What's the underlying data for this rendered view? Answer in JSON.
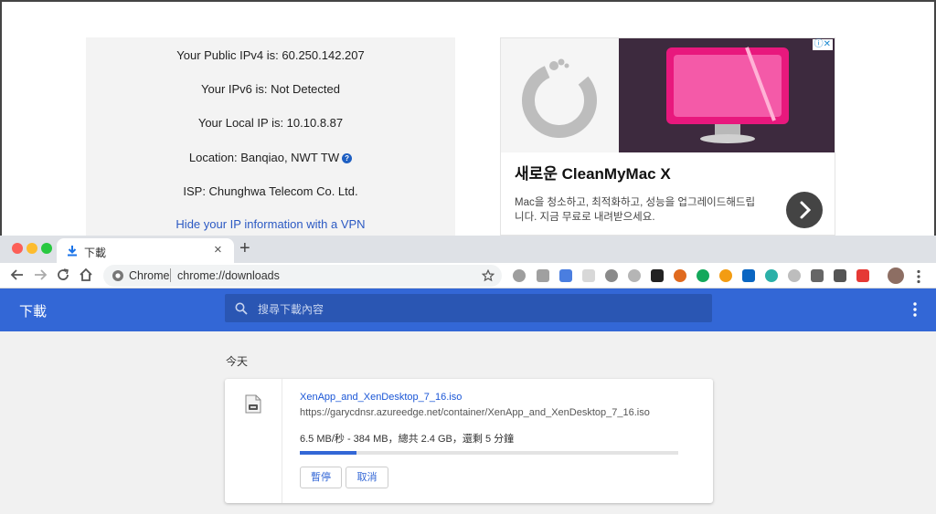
{
  "background_page": {
    "ip_info": {
      "public_ipv4": "Your Public IPv4 is: 60.250.142.207",
      "ipv6": "Your IPv6 is: Not Detected",
      "local_ip": "Your Local IP is: 10.10.8.87",
      "location": "Location: Banqiao, NWT TW",
      "isp": "ISP: Chunghwa Telecom Co. Ltd.",
      "hide_ip_link": "Hide your IP information with a VPN"
    },
    "ad": {
      "title": "새로운 CleanMyMac X",
      "body": "Mac을 청소하고, 최적화하고, 성능을 업그레이드해드립니다. 지금 무료로 내려받으세요.",
      "choices_label": "ⓘ✕",
      "hero_color": "#3d2a3e",
      "accent_pink": "#e8187d"
    }
  },
  "browser": {
    "tab": {
      "title": "下載",
      "close_glyph": "×"
    },
    "new_tab_glyph": "+",
    "omnibox": {
      "site_label": "Chrome",
      "url": "chrome://downloads"
    },
    "extension_icons": [
      {
        "name": "circle-gray-icon",
        "color": "#9e9e9e"
      },
      {
        "name": "cloud-drive-icon",
        "color": "#a0a0a0"
      },
      {
        "name": "translate-icon",
        "color": "#4a7ee0"
      },
      {
        "name": "page-icon",
        "color": "#d8d8d8"
      },
      {
        "name": "record-icon",
        "color": "#8a8a8a"
      },
      {
        "name": "gray-dot-icon",
        "color": "#b5b5b5"
      },
      {
        "name": "terminal-icon",
        "color": "#222222"
      },
      {
        "name": "half-circle-icon",
        "color": "#e06a1e"
      },
      {
        "name": "chat-bubble-icon",
        "color": "#14a85b"
      },
      {
        "name": "play-icon",
        "color": "#f39c12"
      },
      {
        "name": "linkedin-icon",
        "color": "#0a66c2"
      },
      {
        "name": "target-icon",
        "color": "#2bb0a8"
      },
      {
        "name": "ring-icon",
        "color": "#bdbdbd"
      },
      {
        "name": "screenshot-icon",
        "color": "#666666"
      },
      {
        "name": "camera-icon",
        "color": "#555555"
      },
      {
        "name": "s-extension-icon",
        "color": "#e53935"
      }
    ],
    "header_color": "#3367d6"
  },
  "downloads": {
    "page_title": "下載",
    "search_placeholder": "搜尋下載內容",
    "section_label": "今天",
    "items": [
      {
        "file_name": "XenApp_and_XenDesktop_7_16.iso",
        "url": "https://garycdnsr.azureedge.net/container/XenApp_and_XenDesktop_7_16.iso",
        "progress_text": "6.5 MB/秒 - 384 MB，總共 2.4 GB，還剩 5 分鐘",
        "progress_fraction": 0.15,
        "pause_label": "暫停",
        "cancel_label": "取消"
      }
    ]
  }
}
